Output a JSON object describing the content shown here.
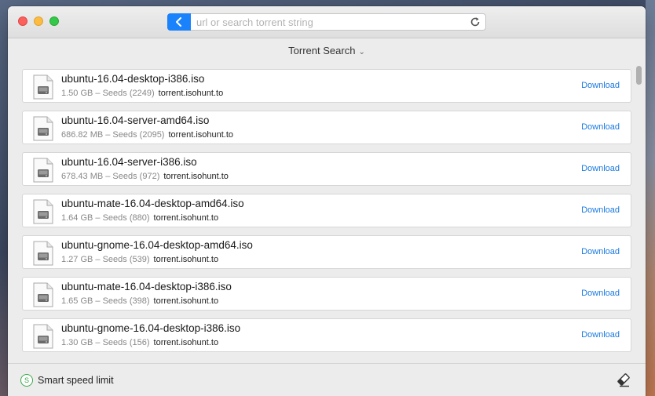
{
  "toolbar": {
    "search_placeholder": "url or search torrent string",
    "search_value": ""
  },
  "section": {
    "title": "Torrent Search"
  },
  "results": [
    {
      "name": "ubuntu-16.04-desktop-i386.iso",
      "meta": "1.50 GB – Seeds (2249)",
      "host": "torrent.isohunt.to",
      "action": "Download"
    },
    {
      "name": "ubuntu-16.04-server-amd64.iso",
      "meta": "686.82 MB – Seeds (2095)",
      "host": "torrent.isohunt.to",
      "action": "Download"
    },
    {
      "name": "ubuntu-16.04-server-i386.iso",
      "meta": "678.43 MB – Seeds (972)",
      "host": "torrent.isohunt.to",
      "action": "Download"
    },
    {
      "name": "ubuntu-mate-16.04-desktop-amd64.iso",
      "meta": "1.64 GB – Seeds (880)",
      "host": "torrent.isohunt.to",
      "action": "Download"
    },
    {
      "name": "ubuntu-gnome-16.04-desktop-amd64.iso",
      "meta": "1.27 GB – Seeds (539)",
      "host": "torrent.isohunt.to",
      "action": "Download"
    },
    {
      "name": "ubuntu-mate-16.04-desktop-i386.iso",
      "meta": "1.65 GB – Seeds (398)",
      "host": "torrent.isohunt.to",
      "action": "Download"
    },
    {
      "name": "ubuntu-gnome-16.04-desktop-i386.iso",
      "meta": "1.30 GB – Seeds (156)",
      "host": "torrent.isohunt.to",
      "action": "Download"
    }
  ],
  "footer": {
    "speed_toggle_letter": "S",
    "speed_label": "Smart speed limit"
  },
  "colors": {
    "accent": "#1a82fb",
    "link": "#1a7ae0",
    "speed_green": "#39a84a"
  },
  "icons": {
    "back": "chevron-left-icon",
    "reload": "reload-icon",
    "file": "disk-image-file-icon",
    "clear": "eraser-icon"
  }
}
